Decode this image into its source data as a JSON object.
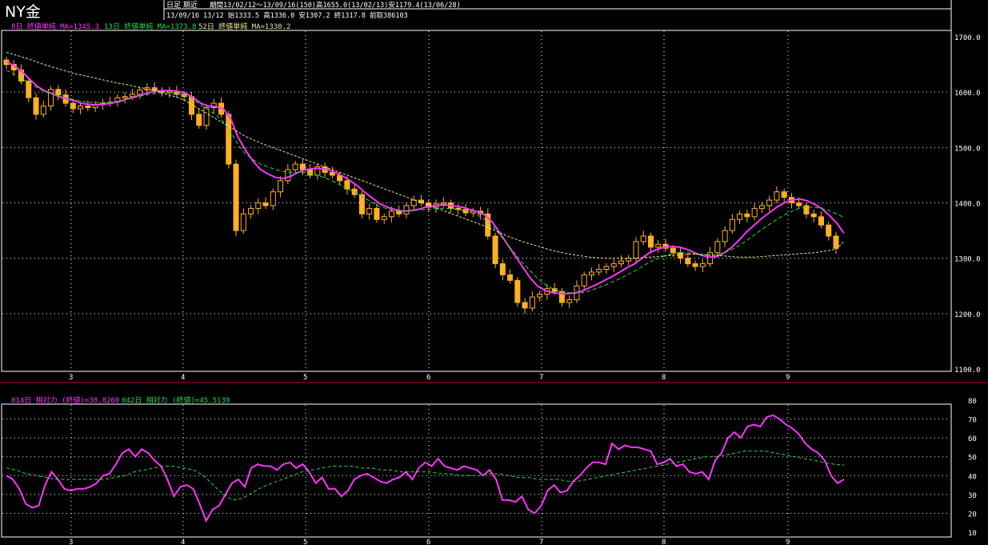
{
  "header": {
    "symbol": "NY金",
    "period_type": "日足 期近",
    "info_line1": "期間13/02/12～13/09/16(150)高1655.0(13/02/13)安1179.4(13/06/28)",
    "info_line2": "13/09/16 13/12 始1333.5 高1336.0 安1307.2 終1317.8 前取386103"
  },
  "legend_top": {
    "ma1": "8日 終値単純 MA=1345.3",
    "ma2": "13日 終値単純 MA=1373.8",
    "ma3": "52日 終値単純 MA=1330.2"
  },
  "legend_bottom": {
    "rsi1": "014日 相対力 (終値)=38.8260",
    "rsi2": "042日 相対力 (終値)=45.5139"
  },
  "colors": {
    "candle": "#ffb020",
    "ma1": "#ff33ff",
    "ma2": "#22dd44",
    "ma3": "#e8e890",
    "grid": "#ffffff",
    "separator": "#cc0000"
  },
  "chart_data": [
    {
      "type": "candlestick",
      "ylim": [
        1100,
        1700
      ],
      "yticks": [
        "1700.0",
        "1600.0",
        "1500.0",
        "1400.0",
        "1300.0",
        "1200.0",
        "1100.0"
      ],
      "xticks": [
        "3",
        "4",
        "5",
        "6",
        "7",
        "8",
        "9"
      ],
      "close": [
        1650,
        1640,
        1620,
        1590,
        1560,
        1575,
        1605,
        1595,
        1580,
        1570,
        1575,
        1572,
        1578,
        1580,
        1582,
        1590,
        1592,
        1596,
        1604,
        1608,
        1603,
        1600,
        1602,
        1596,
        1592,
        1560,
        1540,
        1572,
        1580,
        1560,
        1470,
        1350,
        1380,
        1390,
        1400,
        1395,
        1420,
        1440,
        1460,
        1470,
        1460,
        1450,
        1465,
        1455,
        1450,
        1440,
        1425,
        1415,
        1380,
        1390,
        1370,
        1375,
        1385,
        1380,
        1395,
        1405,
        1400,
        1392,
        1398,
        1400,
        1390,
        1388,
        1382,
        1385,
        1380,
        1340,
        1290,
        1270,
        1260,
        1220,
        1210,
        1230,
        1235,
        1245,
        1240,
        1220,
        1225,
        1250,
        1270,
        1275,
        1280,
        1285,
        1290,
        1295,
        1300,
        1330,
        1340,
        1320,
        1325,
        1318,
        1310,
        1300,
        1290,
        1285,
        1290,
        1310,
        1330,
        1350,
        1370,
        1380,
        1375,
        1390,
        1395,
        1405,
        1420,
        1410,
        1400,
        1395,
        1380,
        1375,
        1360,
        1340,
        1318
      ],
      "series": [
        {
          "name": "8日 終値単純",
          "values": [
            1655,
            1648,
            1638,
            1625,
            1612,
            1603,
            1598,
            1592,
            1588,
            1585,
            1580,
            1578,
            1577,
            1578,
            1580,
            1583,
            1587,
            1591,
            1595,
            1599,
            1602,
            1603,
            1603,
            1601,
            1598,
            1590,
            1580,
            1575,
            1574,
            1570,
            1552,
            1518,
            1495,
            1475,
            1460,
            1452,
            1446,
            1444,
            1448,
            1455,
            1460,
            1462,
            1462,
            1460,
            1455,
            1448,
            1440,
            1430,
            1418,
            1408,
            1398,
            1392,
            1388,
            1385,
            1386,
            1388,
            1392,
            1394,
            1396,
            1396,
            1394,
            1392,
            1388,
            1384,
            1378,
            1365,
            1345,
            1325,
            1305,
            1285,
            1265,
            1250,
            1242,
            1238,
            1236,
            1236,
            1237,
            1241,
            1247,
            1253,
            1260,
            1267,
            1275,
            1283,
            1290,
            1300,
            1310,
            1316,
            1320,
            1321,
            1320,
            1316,
            1310,
            1305,
            1302,
            1303,
            1310,
            1320,
            1333,
            1348,
            1360,
            1372,
            1382,
            1392,
            1400,
            1405,
            1407,
            1404,
            1398,
            1390,
            1378,
            1364,
            1345.3
          ]
        },
        {
          "name": "13日 終値単純",
          "values": [
            1640,
            1632,
            1625,
            1617,
            1609,
            1602,
            1597,
            1593,
            1590,
            1587,
            1584,
            1582,
            1581,
            1581,
            1582,
            1584,
            1587,
            1590,
            1593,
            1596,
            1598,
            1599,
            1599,
            1597,
            1593,
            1586,
            1577,
            1568,
            1559,
            1547,
            1528,
            1505,
            1488,
            1478,
            1470,
            1465,
            1460,
            1457,
            1455,
            1455,
            1455,
            1452,
            1448,
            1443,
            1437,
            1430,
            1423,
            1416,
            1408,
            1400,
            1393,
            1389,
            1386,
            1385,
            1386,
            1387,
            1388,
            1389,
            1390,
            1390,
            1389,
            1387,
            1384,
            1378,
            1370,
            1358,
            1342,
            1325,
            1308,
            1292,
            1278,
            1264,
            1253,
            1245,
            1240,
            1238,
            1237,
            1238,
            1241,
            1246,
            1251,
            1257,
            1263,
            1270,
            1277,
            1285,
            1293,
            1299,
            1304,
            1308,
            1310,
            1310,
            1308,
            1306,
            1305,
            1306,
            1310,
            1316,
            1323,
            1332,
            1342,
            1352,
            1361,
            1370,
            1378,
            1385,
            1390,
            1392,
            1392,
            1390,
            1386,
            1380,
            1373.8
          ]
        },
        {
          "name": "52日 終値単純",
          "values": [
            1672,
            1668,
            1664,
            1660,
            1655,
            1650,
            1646,
            1642,
            1638,
            1634,
            1631,
            1628,
            1625,
            1622,
            1619,
            1616,
            1614,
            1611,
            1608,
            1605,
            1602,
            1598,
            1594,
            1590,
            1584,
            1576,
            1568,
            1560,
            1552,
            1544,
            1536,
            1528,
            1520,
            1514,
            1508,
            1503,
            1498,
            1493,
            1488,
            1483,
            1478,
            1473,
            1468,
            1463,
            1458,
            1453,
            1448,
            1443,
            1438,
            1433,
            1428,
            1423,
            1418,
            1413,
            1408,
            1403,
            1398,
            1393,
            1388,
            1383,
            1378,
            1373,
            1368,
            1363,
            1358,
            1352,
            1346,
            1340,
            1335,
            1330,
            1326,
            1322,
            1318,
            1314,
            1311,
            1308,
            1306,
            1304,
            1302,
            1301,
            1300,
            1300,
            1300,
            1300,
            1300,
            1301,
            1302,
            1303,
            1304,
            1305,
            1306,
            1307,
            1307,
            1307,
            1306,
            1305,
            1304,
            1303,
            1302,
            1302,
            1302,
            1303,
            1304,
            1305,
            1306,
            1307,
            1308,
            1309,
            1310,
            1312,
            1314,
            1317,
            1330.2
          ]
        }
      ]
    },
    {
      "type": "line",
      "ylim": [
        10,
        80
      ],
      "yticks": [
        "80",
        "70",
        "60",
        "50",
        "40",
        "30",
        "20",
        "10"
      ],
      "xticks": [
        "3",
        "4",
        "5",
        "6",
        "7",
        "8",
        "9"
      ],
      "series": [
        {
          "name": "014日 相対力 (終値)",
          "values": [
            40,
            38,
            33,
            25,
            23,
            24,
            35,
            42,
            38,
            33,
            32,
            33,
            33,
            34,
            36,
            40,
            41,
            46,
            52,
            54,
            50,
            54,
            52,
            48,
            45,
            38,
            29,
            34,
            35,
            33,
            25,
            16,
            22,
            24,
            30,
            36,
            38,
            34,
            44,
            46,
            45,
            45,
            43,
            46,
            47,
            44,
            46,
            42,
            36,
            39,
            33,
            33,
            29,
            32,
            38,
            40,
            41,
            39,
            37,
            36,
            38,
            39,
            42,
            38,
            44,
            47,
            45,
            49,
            45,
            44,
            43,
            45,
            44,
            43,
            40,
            43,
            38,
            27,
            27,
            26,
            29,
            22,
            20,
            24,
            32,
            35,
            31,
            32,
            37,
            40,
            44,
            47,
            47,
            46,
            57,
            54,
            56,
            55,
            55,
            54,
            53,
            46,
            47,
            49,
            45,
            46,
            42,
            41,
            42,
            38,
            48,
            52,
            60,
            63,
            60,
            66,
            67,
            66,
            71,
            72,
            70,
            67,
            65,
            62,
            57,
            54,
            52,
            48,
            40,
            36,
            38
          ]
        },
        {
          "name": "042日 相対力 (終値)",
          "values": [
            44,
            43,
            41,
            40,
            39,
            38,
            38,
            38,
            38,
            38,
            38,
            39,
            40,
            42,
            43,
            44,
            45,
            45,
            44,
            43,
            40,
            35,
            30,
            27,
            28,
            31,
            34,
            36,
            38,
            40,
            42,
            43,
            44,
            45,
            45,
            45,
            44,
            44,
            43,
            43,
            42,
            42,
            42,
            42,
            41,
            41,
            40,
            40,
            40,
            41,
            41,
            40,
            39,
            39,
            38,
            38,
            38,
            37,
            37,
            38,
            39,
            40,
            41,
            42,
            43,
            44,
            45,
            46,
            47,
            48,
            49,
            50,
            50,
            51,
            52,
            53,
            53,
            53,
            52,
            51,
            50,
            49,
            48,
            47,
            46,
            45.5
          ]
        }
      ]
    }
  ]
}
